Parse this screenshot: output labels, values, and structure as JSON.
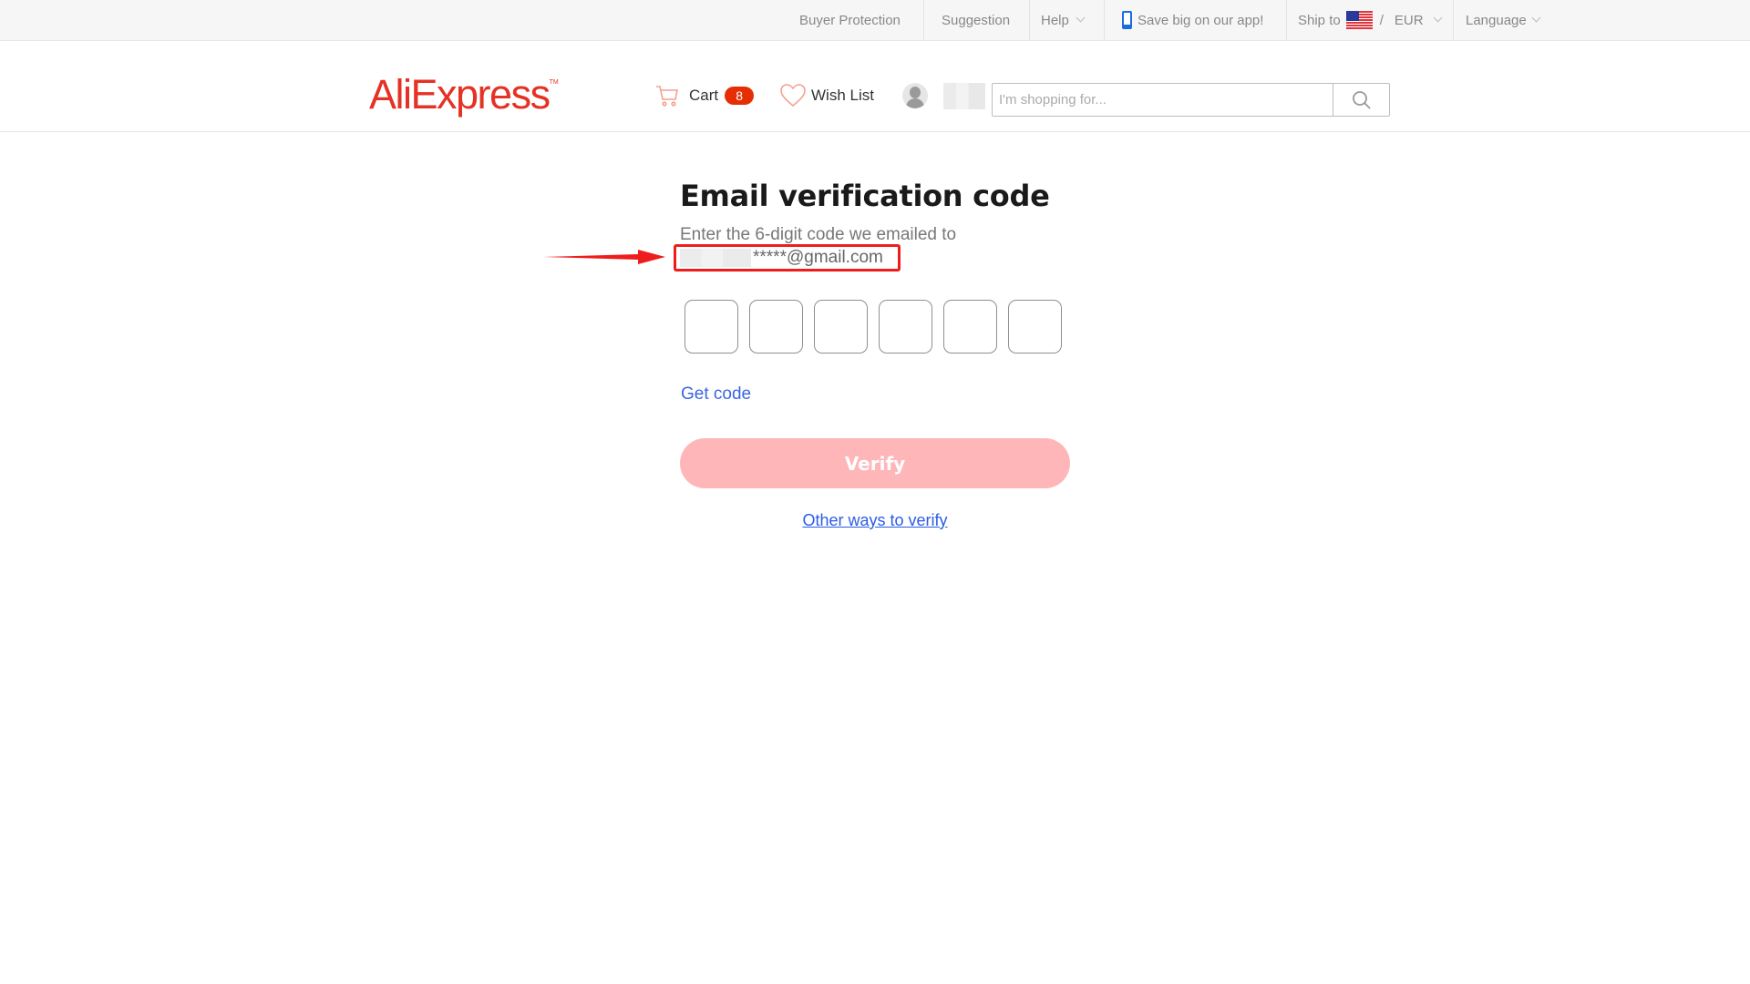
{
  "topbar": {
    "buyer_protection": "Buyer Protection",
    "suggestion": "Suggestion",
    "help": "Help",
    "app_promo": "Save big on our app!",
    "ship_to": "Ship to",
    "ship_country_flag": "us-flag-icon",
    "separator": "/",
    "currency": "EUR",
    "language": "Language"
  },
  "header": {
    "logo": "AliExpress",
    "logo_tm": "TM",
    "cart_label": "Cart",
    "cart_count": "8",
    "wishlist_label": "Wish List",
    "search_placeholder": "I'm shopping for...",
    "search_value": ""
  },
  "main": {
    "title": "Email verification code",
    "subtitle": "Enter the 6-digit code we emailed to",
    "email_masked": "*****@gmail.com",
    "code_digits": [
      "",
      "",
      "",
      "",
      "",
      ""
    ],
    "get_code": "Get code",
    "verify": "Verify",
    "other_ways": "Other ways to verify"
  },
  "colors": {
    "brand": "#e43225",
    "badge": "#e62e04",
    "link": "#3a66e0",
    "verify_disabled": "#ffb6b9",
    "annotation": "#ee1d1d"
  }
}
